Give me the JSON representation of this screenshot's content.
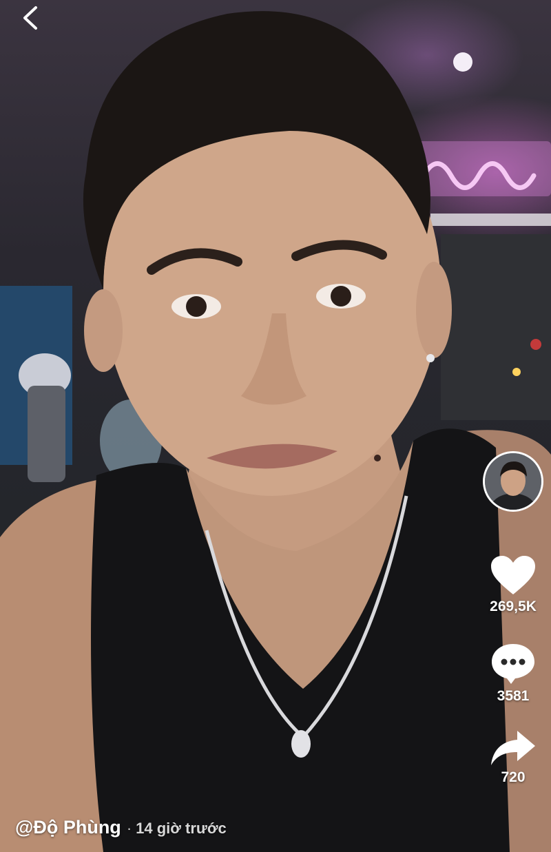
{
  "video": {
    "subject": "man in black tank top with silver chain necklace, neon-lit room"
  },
  "topbar": {
    "back_icon": "chevron-left-icon"
  },
  "rail": {
    "avatar_icon": "creator-avatar",
    "like": {
      "icon": "heart-icon",
      "count": "269,5K",
      "color": "#ffffff"
    },
    "comment": {
      "icon": "comment-bubble-icon",
      "count": "3581",
      "color": "#ffffff"
    },
    "share": {
      "icon": "share-arrow-icon",
      "count": "720",
      "color": "#ffffff"
    }
  },
  "caption": {
    "username": "@Độ Phùng",
    "separator": "·",
    "posted": "14 giờ trước"
  }
}
